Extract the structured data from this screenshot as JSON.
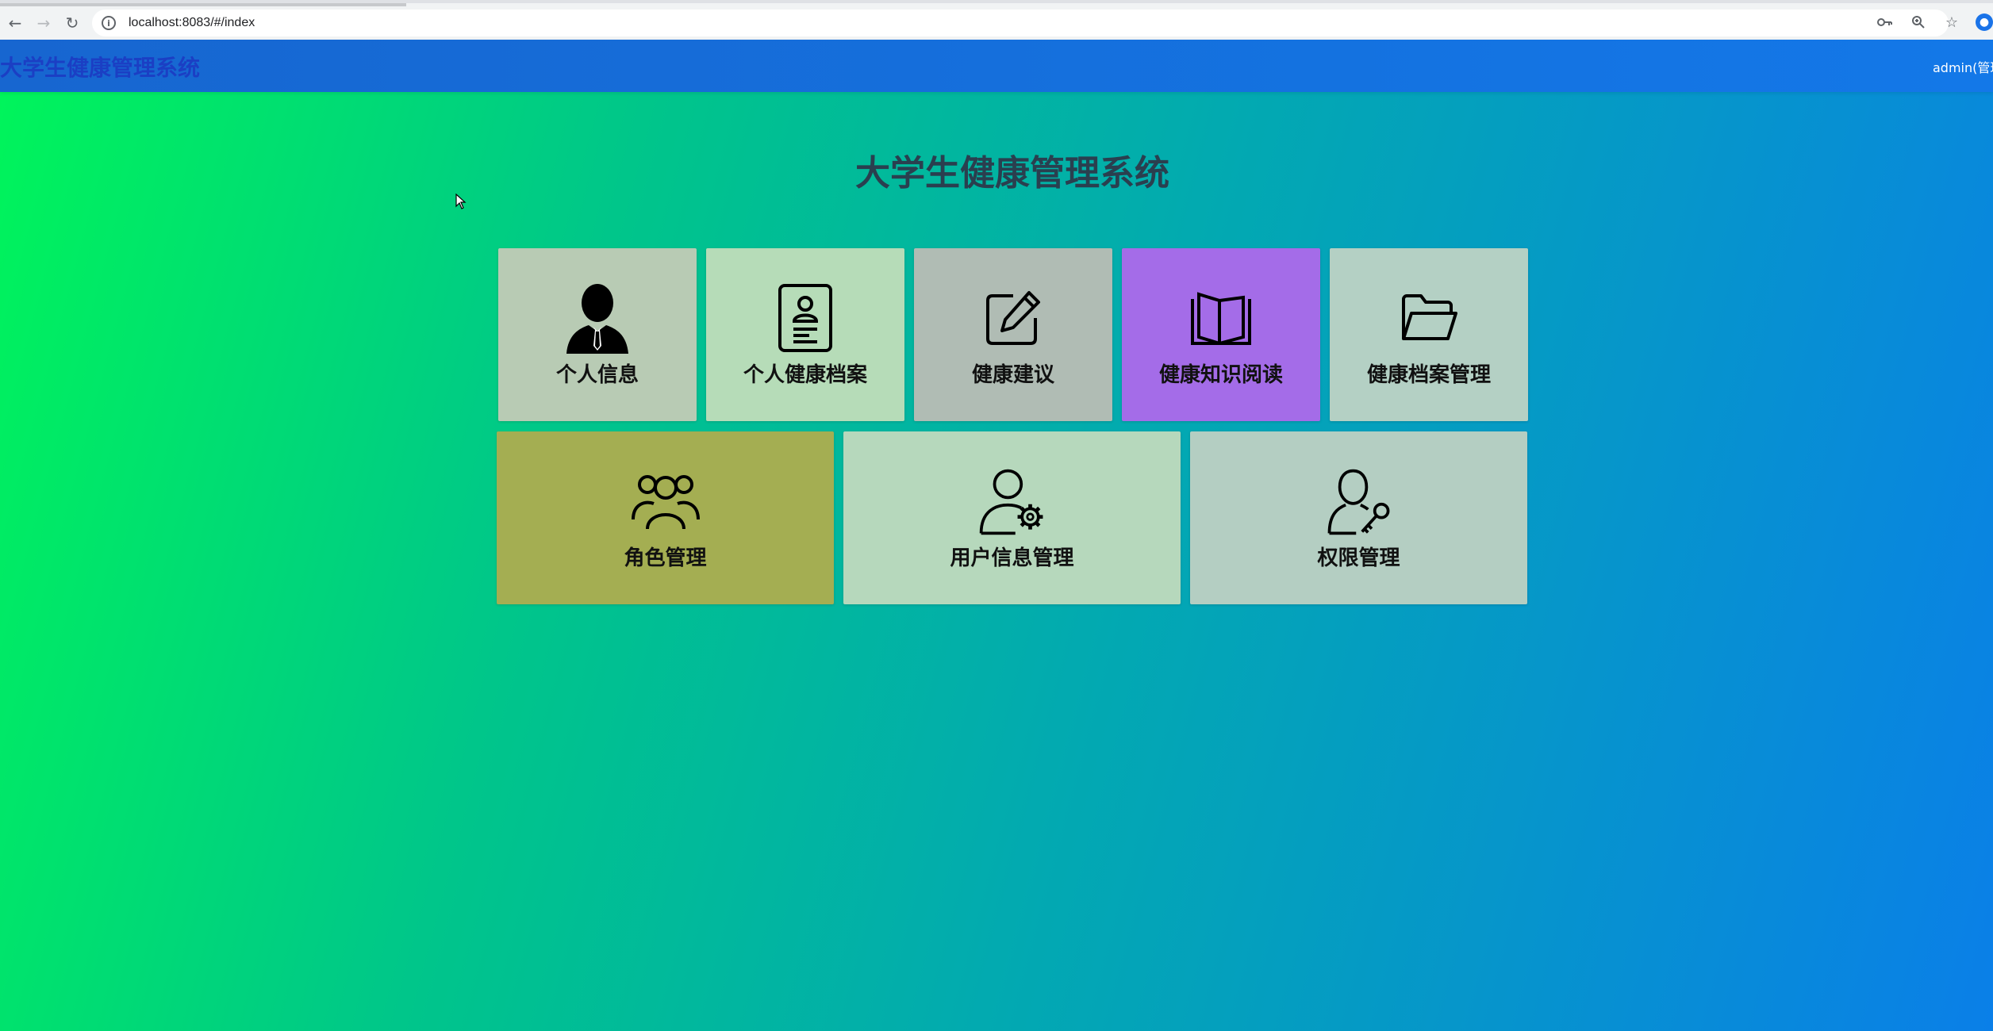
{
  "browser": {
    "url": "localhost:8083/#/index"
  },
  "header": {
    "brand": "大学生健康管理系统",
    "user": "admin(管理"
  },
  "main": {
    "title": "大学生健康管理系统"
  },
  "tiles_row1": [
    {
      "label": "个人信息",
      "icon": "person-tie-icon",
      "color": "#b8cbb4"
    },
    {
      "label": "个人健康档案",
      "icon": "id-badge-icon",
      "color": "#b6dcb8"
    },
    {
      "label": "健康建议",
      "icon": "edit-note-icon",
      "color": "#b0bcb4"
    },
    {
      "label": "健康知识阅读",
      "icon": "open-book-icon",
      "color": "#a46ce8"
    },
    {
      "label": "健康档案管理",
      "icon": "folder-open-icon",
      "color": "#b4d0c4"
    }
  ],
  "tiles_row2": [
    {
      "label": "角色管理",
      "icon": "user-group-icon",
      "color": "#a4ae52"
    },
    {
      "label": "用户信息管理",
      "icon": "user-gear-icon",
      "color": "#b6d8bc"
    },
    {
      "label": "权限管理",
      "icon": "user-key-icon",
      "color": "#b4cec2"
    }
  ]
}
